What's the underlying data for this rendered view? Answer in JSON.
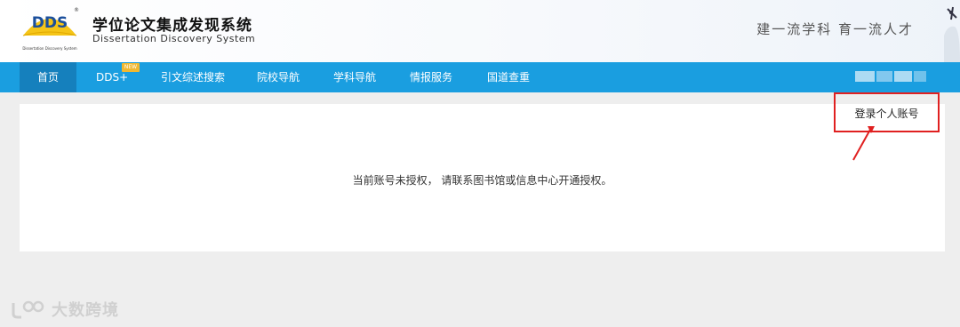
{
  "header": {
    "logo_text": "DDS",
    "logo_subtitle": "Dissertation Discovery System",
    "logo_reg": "®",
    "title_cn": "学位论文集成发现系统",
    "title_en": "Dissertation Discovery System",
    "slogan": "建一流学科  育一流人才"
  },
  "nav": {
    "items": [
      {
        "label": "首页",
        "active": true
      },
      {
        "label": "DDS+",
        "badge": "NEW"
      },
      {
        "label": "引文综述搜索"
      },
      {
        "label": "院校导航"
      },
      {
        "label": "学科导航"
      },
      {
        "label": "情报服务"
      },
      {
        "label": "国道查重"
      }
    ]
  },
  "main": {
    "message": "当前账号未授权， 请联系图书馆或信息中心开通授权。"
  },
  "annotation": {
    "label": "登录个人账号",
    "color": "#e02020"
  },
  "watermark": {
    "text": "大数跨境"
  },
  "colors": {
    "nav_bg": "#1a9ee0",
    "nav_active": "#1580bd",
    "logo_yellow": "#f5c518",
    "logo_blue": "#1b4f9c"
  }
}
